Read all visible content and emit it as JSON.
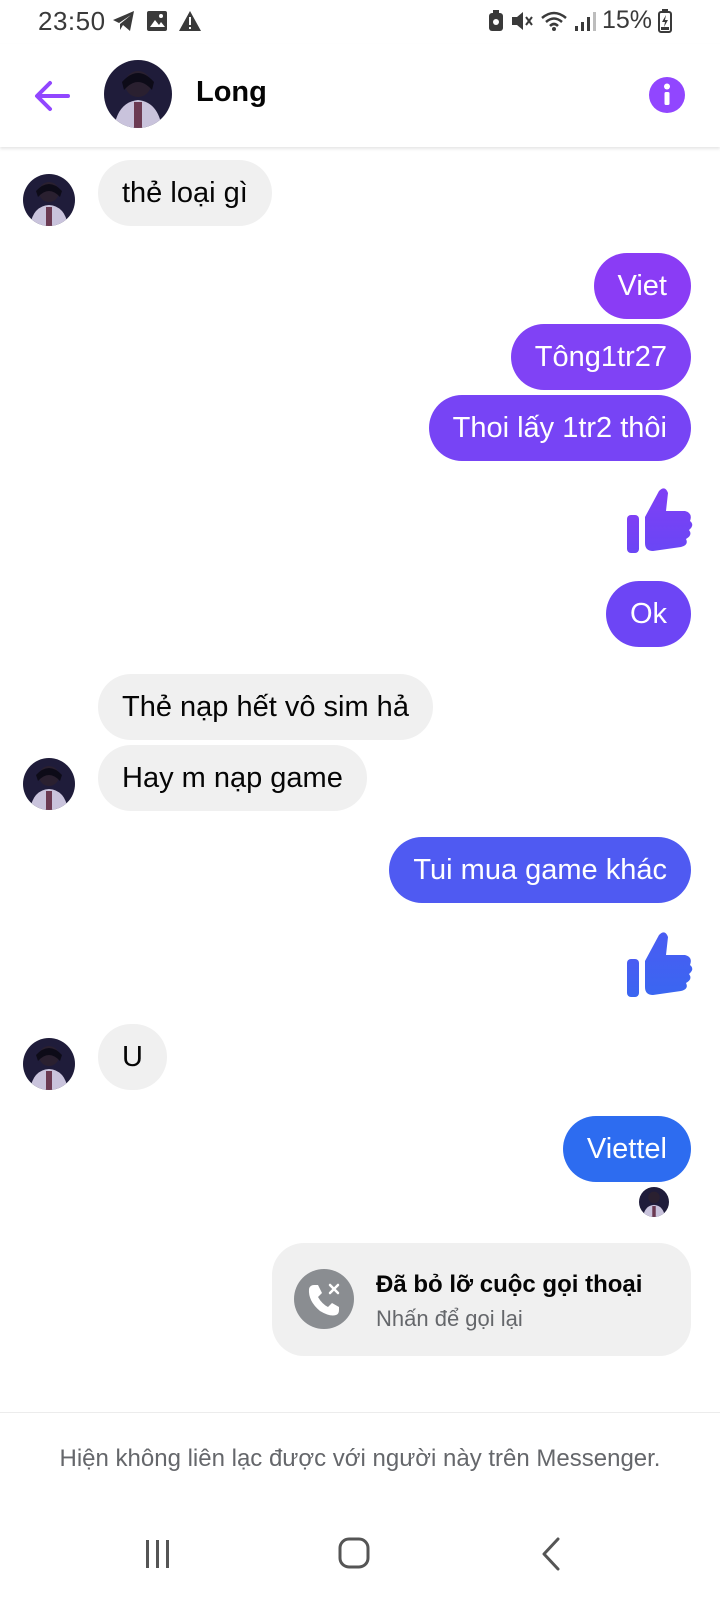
{
  "status_bar": {
    "time": "23:50",
    "battery": "15%"
  },
  "header": {
    "contact_name": "Long"
  },
  "colors": {
    "accent": "#9146ff",
    "bubble_purple": "#8a3cf5",
    "bubble_violet": "#6d45f5",
    "bubble_indigo": "#4f5af2",
    "bubble_blue": "#2d6cf0",
    "incoming_bubble": "#f0f0f0"
  },
  "messages": [
    {
      "from": "contact",
      "text": "thẻ loại gì"
    },
    {
      "from": "me",
      "text": "Viet"
    },
    {
      "from": "me",
      "text": "Tông1tr27"
    },
    {
      "from": "me",
      "text": "Thoi lấy 1tr2 thôi"
    },
    {
      "from": "me",
      "type": "like",
      "icon": "thumbs-up-icon"
    },
    {
      "from": "me",
      "text": "Ok"
    },
    {
      "from": "contact",
      "text": "Thẻ nạp hết vô sim hả"
    },
    {
      "from": "contact",
      "text": "Hay m nạp game"
    },
    {
      "from": "me",
      "text": "Tui mua game khác"
    },
    {
      "from": "me",
      "type": "like",
      "icon": "thumbs-up-icon"
    },
    {
      "from": "contact",
      "text": "U"
    },
    {
      "from": "me",
      "text": "Viettel"
    }
  ],
  "missed_call": {
    "title": "Đã bỏ lỡ cuộc gọi thoại",
    "subtitle": "Nhấn để gọi lại",
    "icon": "missed-call-icon"
  },
  "footer": {
    "notice": "Hiện không liên lạc được với người này trên Messenger."
  }
}
